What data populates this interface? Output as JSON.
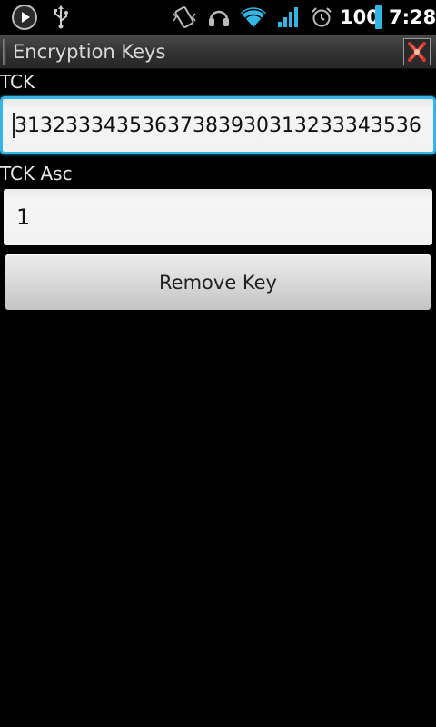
{
  "status_bar": {
    "icons": [
      "play-icon",
      "usb-icon",
      "vibrate-icon",
      "headset-icon",
      "wifi-icon",
      "signal-icon",
      "battery-icon",
      "alarm-icon"
    ],
    "battery_percent": "100",
    "time": "7:28",
    "accent_color": "#33b5e5"
  },
  "title_bar": {
    "title": "Encryption Keys"
  },
  "form": {
    "tck_label": "TCK",
    "tck_value": "31323334353637383930313233343536",
    "tck_asc_label": "TCK Asc",
    "tck_asc_value": "1",
    "remove_button_label": "Remove Key"
  },
  "colors": {
    "focus_border": "#33b5e5",
    "background": "#000000"
  }
}
